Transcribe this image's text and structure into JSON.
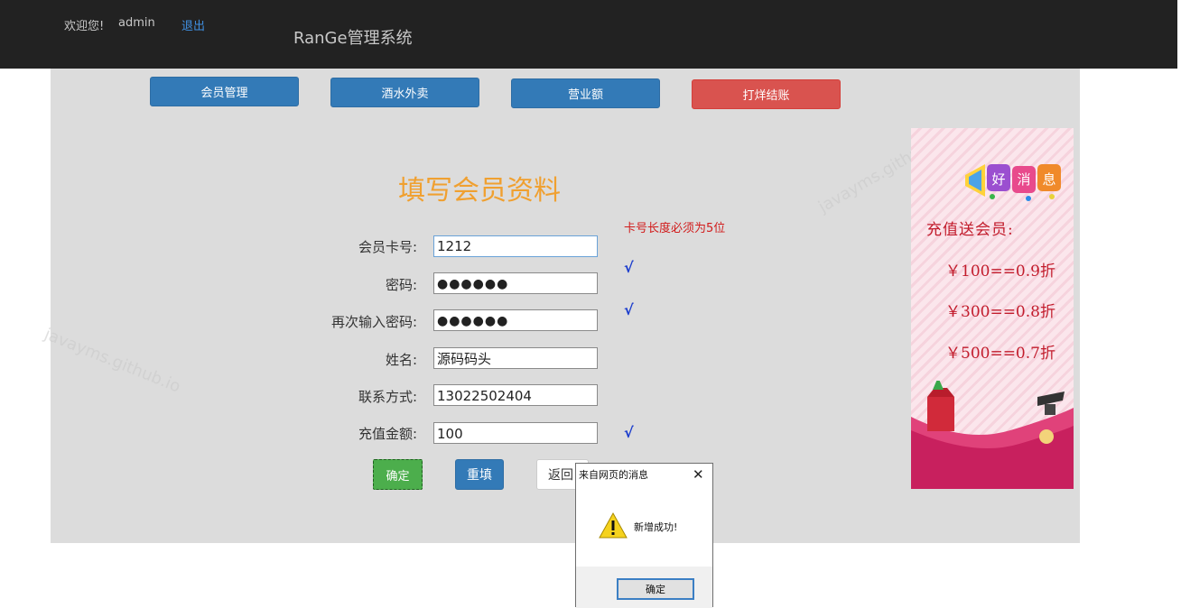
{
  "header": {
    "welcome": "欢迎您!",
    "username": "admin",
    "logout": "退出",
    "brand": "RanGe管理系统"
  },
  "nav": {
    "member": "会员管理",
    "drinks": "酒水外卖",
    "revenue": "营业额",
    "checkout": "打烊结账"
  },
  "form": {
    "title": "填写会员资料",
    "card_label": "会员卡号:",
    "card_value": "1212",
    "card_hint": "卡号长度必须为5位",
    "password_label": "密码:",
    "password_value": "●●●●●●",
    "password_check": "√",
    "confirm_label": "再次输入密码:",
    "confirm_value": "●●●●●●",
    "confirm_check": "√",
    "name_label": "姓名:",
    "name_value": "源码码头",
    "phone_label": "联系方式:",
    "phone_value": "13022502404",
    "amount_label": "充值金额:",
    "amount_value": "100",
    "amount_check": "√",
    "submit": "确定",
    "reset": "重填",
    "back": "返回"
  },
  "promo": {
    "badge": "好消息",
    "title": "充值送会员:",
    "offers": [
      "￥100==0.9折",
      "￥300==0.8折",
      "￥500==0.7折"
    ]
  },
  "watermark": "javayms.github.io",
  "dialog": {
    "title": "来自网页的消息",
    "close": "✕",
    "message": "新增成功!",
    "ok": "确定"
  },
  "colors": {
    "topbar": "#222222",
    "primary": "#337ab7",
    "danger": "#d9534f",
    "success": "#4cae4c",
    "title_orange": "#f0a030",
    "hint_red": "#d11b1b",
    "check_blue": "#1a3ccd"
  }
}
